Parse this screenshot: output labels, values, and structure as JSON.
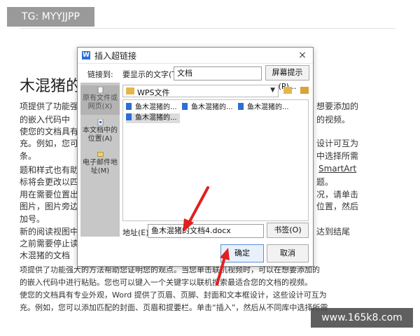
{
  "watermark_tag": "TG: MYYJJPP",
  "site_watermark": "www.165k8.com",
  "document": {
    "title": "木混猪的",
    "lines": [
      "项提供了功能强",
      "的嵌入代码中",
      "使您的文档具有",
      "充。例如，您可",
      "条。",
      "题和样式也有助",
      "标将会更改以四",
      "用在需要位置出",
      "图片，图片旁边",
      "加号。",
      "新的阅读视图中",
      "之前需要停止读",
      "木混猪的文档",
      "项提供了功能强大的方法帮助您证明您的观点。当您单击联机视频时，可以在想要添加的",
      "的嵌入代码中进行粘贴。您也可以键入一个关键字以联机搜索最适合您的文档的视频。",
      "使您的文档具有专业外观，Word 提供了页眉、页脚、封面和文本框设计，这些设计可互为",
      "充。例如，您可以添加匹配的封面、页眉和提要栏。单击“插入”，然后从不同库中选择所需"
    ],
    "right_column": [
      "想要添加的",
      "的视频。",
      "设计可互为",
      "中选择所需",
      "SmartArt",
      "题。",
      "况，请单击",
      "位置，然后",
      "达到结尾"
    ]
  },
  "dialog": {
    "title": "插入超链接",
    "link_to_label": "链接到:",
    "display_text_label": "要显示的文字(T):",
    "display_text_value": "文档",
    "screen_tip_button": "屏幕提示(P)...",
    "nav": [
      {
        "label": "原有文件或网页(X)",
        "selected": true
      },
      {
        "label": "本文档中的位置(A)",
        "selected": false
      },
      {
        "label": "电子邮件地址(M)",
        "selected": false
      }
    ],
    "folder": "WPS文件",
    "files": [
      "鱼木混猪的...",
      "鱼木混猪的...",
      "鱼木混猪的...",
      "鱼木混猪的..."
    ],
    "address_label": "地址(E):",
    "address_value": "鱼木混猪的文档4.docx",
    "bookmark_button": "书签(O)",
    "ok_button": "确定",
    "cancel_button": "取消",
    "close_symbol": "×"
  },
  "colors": {
    "accent_blue": "#2b6fd6",
    "arrow_red": "#e02020",
    "sidebar_gray": "#c7c7c7"
  }
}
